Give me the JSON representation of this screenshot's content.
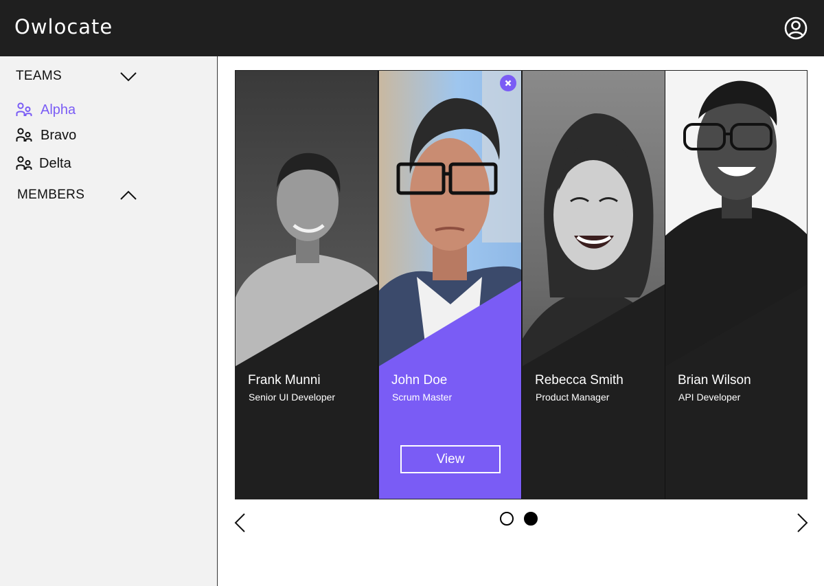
{
  "app": {
    "title": "Owlocate"
  },
  "sidebar": {
    "teams_label": "TEAMS",
    "members_label": "MEMBERS",
    "teams": [
      {
        "label": "Alpha",
        "active": true
      },
      {
        "label": "Bravo",
        "active": false
      },
      {
        "label": "Delta",
        "active": false
      }
    ]
  },
  "cards": [
    {
      "name": "Frank Munni",
      "role": "Senior UI Developer",
      "selected": false
    },
    {
      "name": "John Doe",
      "role": "Scrum Master",
      "selected": true,
      "action_label": "View"
    },
    {
      "name": "Rebecca Smith",
      "role": "Product Manager",
      "selected": false
    },
    {
      "name": "Brian Wilson",
      "role": "API Developer",
      "selected": false
    }
  ],
  "pagination": {
    "pages": 2,
    "current": 2
  },
  "colors": {
    "accent": "#7a5cf5",
    "dark": "#1f1f1f",
    "sidebar": "#f2f2f2"
  },
  "icons": {
    "account": "user-circle-icon",
    "team": "team-people-icon",
    "prev": "chevron-left-icon",
    "next": "chevron-right-icon",
    "close": "close-icon"
  }
}
